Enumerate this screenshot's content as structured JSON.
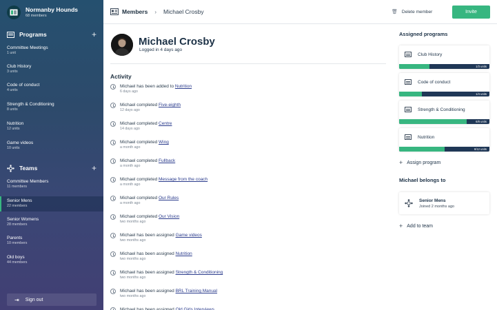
{
  "org": {
    "name": "Normanby Hounds",
    "members": "68 members",
    "logo_icon": "club-logo-icon"
  },
  "sidebar": {
    "programs_heading": "Programs",
    "programs": [
      {
        "label": "Committee Meetings",
        "sub": "1 unit"
      },
      {
        "label": "Club History",
        "sub": "3 units"
      },
      {
        "label": "Code of conduct",
        "sub": "4 units"
      },
      {
        "label": "Strength & Conditioning",
        "sub": "8 units"
      },
      {
        "label": "Nutrition",
        "sub": "12 units"
      },
      {
        "label": "Game videos",
        "sub": "10 units"
      }
    ],
    "teams_heading": "Teams",
    "teams": [
      {
        "label": "Committee Members",
        "sub": "11 members"
      },
      {
        "label": "Senior Mens",
        "sub": "22 members",
        "active": true
      },
      {
        "label": "Senior Womens",
        "sub": "28 members"
      },
      {
        "label": "Parents",
        "sub": "10 members"
      },
      {
        "label": "Old boys",
        "sub": "44 members"
      }
    ],
    "sign_out": "Sign out"
  },
  "header": {
    "breadcrumb_root": "Members",
    "breadcrumb_sep": "›",
    "breadcrumb_current": "Michael Crosby",
    "delete_label": "Delete member",
    "invite_label": "Invite"
  },
  "profile": {
    "name": "Michael Crosby",
    "logged_in": "Logged in 4 days ago"
  },
  "activity": {
    "title": "Activity",
    "items": [
      {
        "text": "Michael has been added to ",
        "link": "Nutrition",
        "when": "6 days ago"
      },
      {
        "text": "Michael completed ",
        "link": "Five-eighth",
        "when": "12 days ago"
      },
      {
        "text": "Michael completed ",
        "link": "Centre",
        "when": "14 days ago"
      },
      {
        "text": "Michael completed ",
        "link": "Wing",
        "when": "a month ago"
      },
      {
        "text": "Michael completed ",
        "link": "Fullback",
        "when": "a month ago"
      },
      {
        "text": "Michael completed ",
        "link": "Message from the coach",
        "when": "a month ago"
      },
      {
        "text": "Michael completed ",
        "link": "Our Rules",
        "when": "a month ago"
      },
      {
        "text": "Michael completed ",
        "link": "Our Vision",
        "when": "two months ago"
      },
      {
        "text": "Michael has been assigned ",
        "link": "Game videos",
        "when": "two months ago"
      },
      {
        "text": "Michael has been assigned ",
        "link": "Nutrition",
        "when": "two months ago"
      },
      {
        "text": "Michael has been assigned ",
        "link": "Strength & Conditioning",
        "when": "two months ago"
      },
      {
        "text": "Michael has been assigned ",
        "link": "BRL Training Manual",
        "when": "two months ago"
      },
      {
        "text": "Michael has been assigned ",
        "link": "Old Girls Interviews",
        "when": ""
      }
    ]
  },
  "assigned": {
    "title": "Assigned programs",
    "programs": [
      {
        "name": "Club History",
        "units": "1/3 units",
        "progress": 0.333
      },
      {
        "name": "Code of conduct",
        "units": "1/4 units",
        "progress": 0.25
      },
      {
        "name": "Strength & Conditioning",
        "units": "6/8 units",
        "progress": 0.75
      },
      {
        "name": "Nutrition",
        "units": "6/12 units",
        "progress": 0.5
      }
    ],
    "assign_label": "Assign program"
  },
  "belongs": {
    "title": "Michael belongs to",
    "team_name": "Senior Mens",
    "team_joined": "Joined 2 months ago",
    "add_label": "Add to team"
  },
  "colors": {
    "accent": "#37b680",
    "progress_track": "#1f3756",
    "link": "#2a3b8c"
  }
}
